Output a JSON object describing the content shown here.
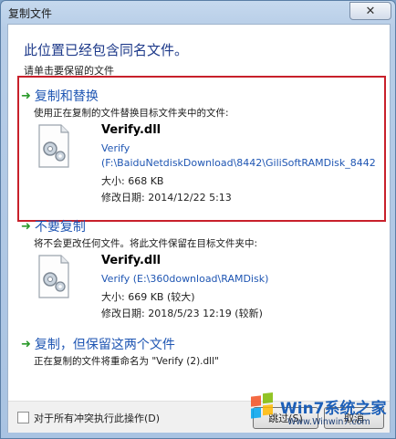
{
  "window": {
    "title": "复制文件",
    "close_symbol": "✕"
  },
  "header": {
    "heading": "此位置已经包含同名文件。",
    "subheading": "请单击要保留的文件"
  },
  "options": [
    {
      "title": "复制和替换",
      "description": "使用正在复制的文件替换目标文件夹中的文件:",
      "file": {
        "name": "Verify.dll",
        "line1": "Verify",
        "line2": "(F:\\BaiduNetdiskDownload\\8442\\GiliSoftRAMDisk_8442",
        "size": "大小: 668 KB",
        "modified": "修改日期: 2014/12/22 5:13"
      }
    },
    {
      "title": "不要复制",
      "description": "将不会更改任何文件。将此文件保留在目标文件夹中:",
      "file": {
        "name": "Verify.dll",
        "line1": "Verify (E:\\360download\\RAMDisk)",
        "size": "大小: 669 KB (较大)",
        "modified": "修改日期: 2018/5/23 12:19 (较新)"
      }
    },
    {
      "title": "复制，但保留这两个文件",
      "description": "正在复制的文件将重命名为 \"Verify (2).dll\""
    }
  ],
  "footer": {
    "apply_all_label": "对于所有冲突执行此操作(D)",
    "skip_label": "跳过(S)",
    "cancel_label": "取消"
  },
  "watermark": {
    "brand": "Win7系统之家",
    "url": "Www.Winwin7.com"
  },
  "colors": {
    "highlight_border": "#c8202b",
    "link_blue": "#1f56b3",
    "arrow_green": "#2b9a2b"
  }
}
